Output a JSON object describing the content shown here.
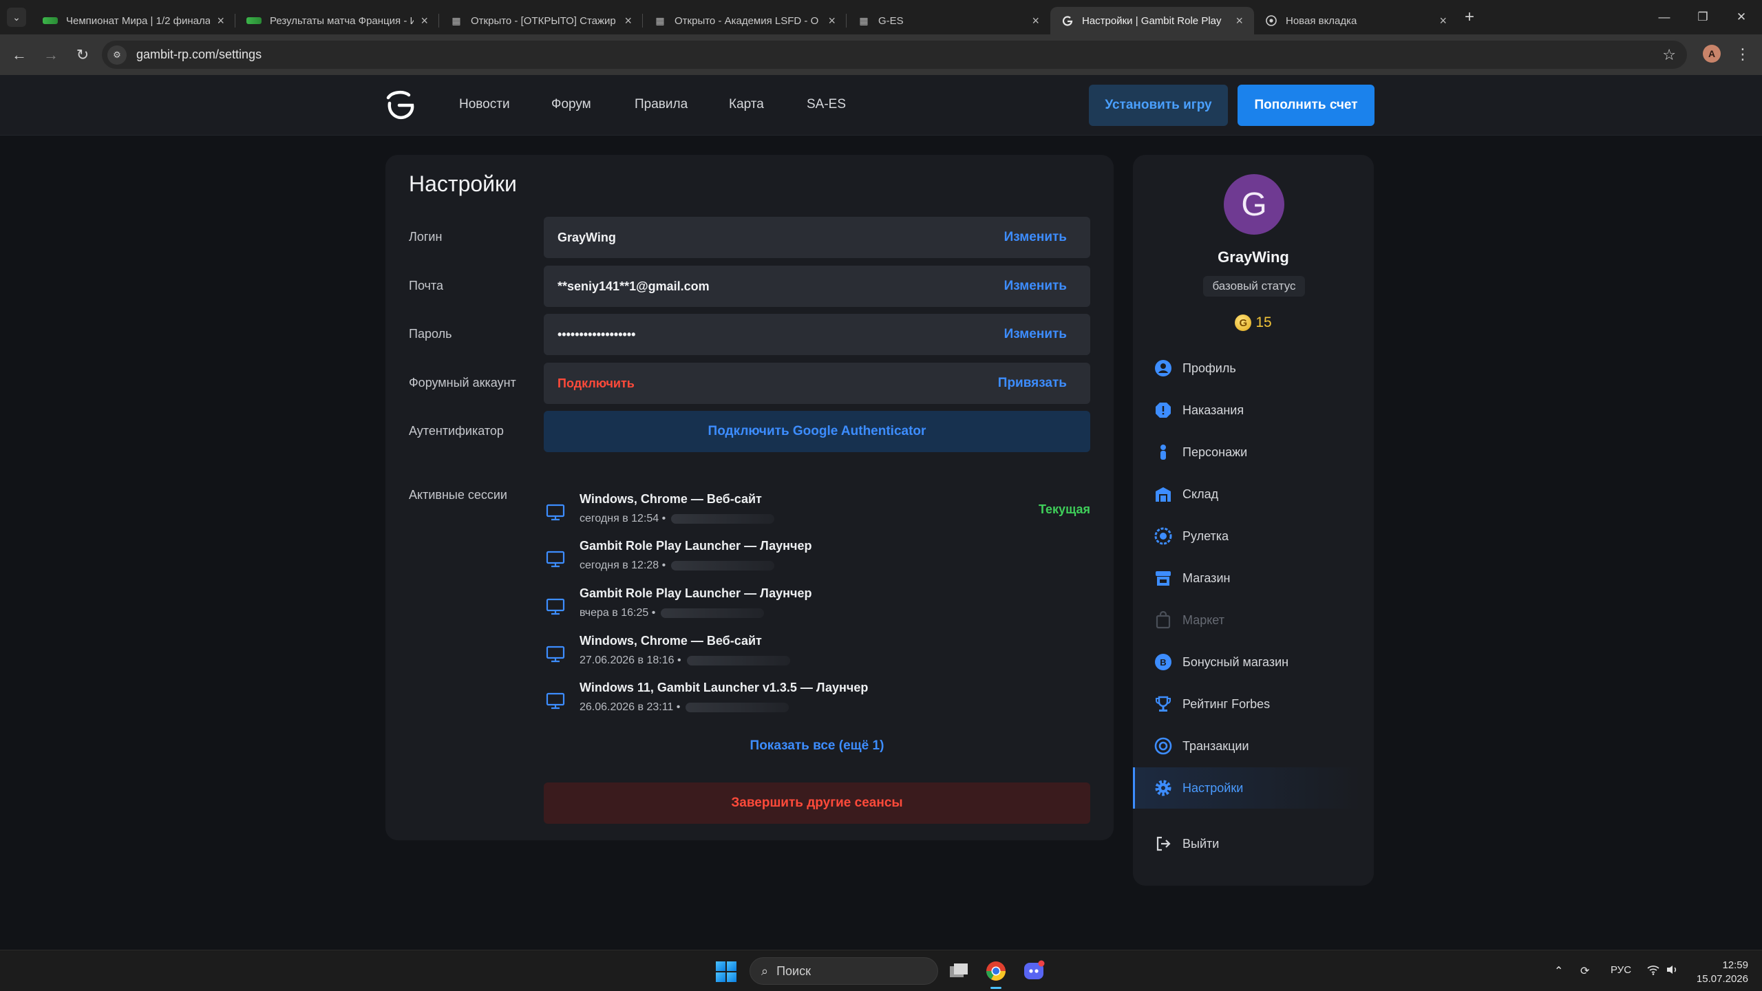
{
  "browser": {
    "tabs": [
      {
        "title": "Чемпионат Мира | 1/2 финала",
        "favicon": "green-flag-icon"
      },
      {
        "title": "Результаты матча Франция - И",
        "favicon": "green-flag-icon"
      },
      {
        "title": "Открыто - [ОТКРЫТО] Стажир",
        "favicon": "forum-icon"
      },
      {
        "title": "Открыто - Академия LSFD - О",
        "favicon": "forum-icon"
      },
      {
        "title": "G-ES",
        "favicon": "forum-icon"
      },
      {
        "title": "Настройки | Gambit Role Play",
        "favicon": "gambit-icon",
        "active": true
      },
      {
        "title": "Новая вкладка",
        "favicon": "chrome-icon"
      }
    ],
    "url": "gambit-rp.com/settings",
    "profile_initial": "A"
  },
  "site": {
    "nav": [
      "Новости",
      "Форум",
      "Правила",
      "Карта",
      "SA-ES"
    ],
    "install_button": "Установить игру",
    "topup_button": "Пополнить счет"
  },
  "settings": {
    "title": "Настройки",
    "rows": [
      {
        "label": "Логин",
        "value": "GrayWing",
        "action": "Изменить"
      },
      {
        "label": "Почта",
        "value": "**seniy141**1@gmail.com",
        "action": "Изменить"
      },
      {
        "label": "Пароль",
        "value": "••••••••••••••••••",
        "action": "Изменить"
      },
      {
        "label": "Форумный аккаунт",
        "value": "Подключить",
        "action": "Привязать"
      }
    ],
    "authenticator": {
      "label": "Аутентификатор",
      "button": "Подключить Google Authenticator"
    },
    "sessions": {
      "label": "Активные сессии",
      "items": [
        {
          "name": "Windows, Chrome — Веб-сайт",
          "time": "сегодня в 12:54 •",
          "current": "Текущая"
        },
        {
          "name": "Gambit Role Play Launcher — Лаунчер",
          "time": "сегодня в 12:28 •"
        },
        {
          "name": "Gambit Role Play Launcher — Лаунчер",
          "time": "вчера в 16:25 •"
        },
        {
          "name": "Windows, Chrome — Веб-сайт",
          "time": "27.06.2026 в 18:16 •"
        },
        {
          "name": "Windows 11, Gambit Launcher v1.3.5 — Лаунчер",
          "time": "26.06.2026 в 23:11 •"
        }
      ],
      "show_all": "Показать все (ещё 1)",
      "end_other": "Завершить другие сеансы"
    }
  },
  "profile": {
    "avatar_letter": "G",
    "username": "GrayWing",
    "status": "базовый статус",
    "coin_symbol": "G",
    "coins": "15",
    "menu": [
      {
        "label": "Профиль",
        "icon": "user-icon"
      },
      {
        "label": "Наказания",
        "icon": "warning-icon"
      },
      {
        "label": "Персонажи",
        "icon": "person-icon"
      },
      {
        "label": "Склад",
        "icon": "warehouse-icon"
      },
      {
        "label": "Рулетка",
        "icon": "roulette-icon"
      },
      {
        "label": "Магазин",
        "icon": "shop-icon"
      },
      {
        "label": "Маркет",
        "icon": "market-icon",
        "disabled": true
      },
      {
        "label": "Бонусный магазин",
        "icon": "bonus-icon"
      },
      {
        "label": "Рейтинг Forbes",
        "icon": "trophy-icon"
      },
      {
        "label": "Транзакции",
        "icon": "transactions-icon"
      },
      {
        "label": "Настройки",
        "icon": "gear-icon",
        "active": true
      },
      {
        "label": "Выйти",
        "icon": "logout-icon"
      }
    ]
  },
  "taskbar": {
    "search_placeholder": "Поиск",
    "language": "РУС",
    "time": "12:59",
    "date": "15.07.2026"
  },
  "colors": {
    "accent": "#3d8dff",
    "danger": "#ff4a3a",
    "success": "#3fcf5a",
    "card": "#1a1c21",
    "field": "#2a2d34"
  }
}
